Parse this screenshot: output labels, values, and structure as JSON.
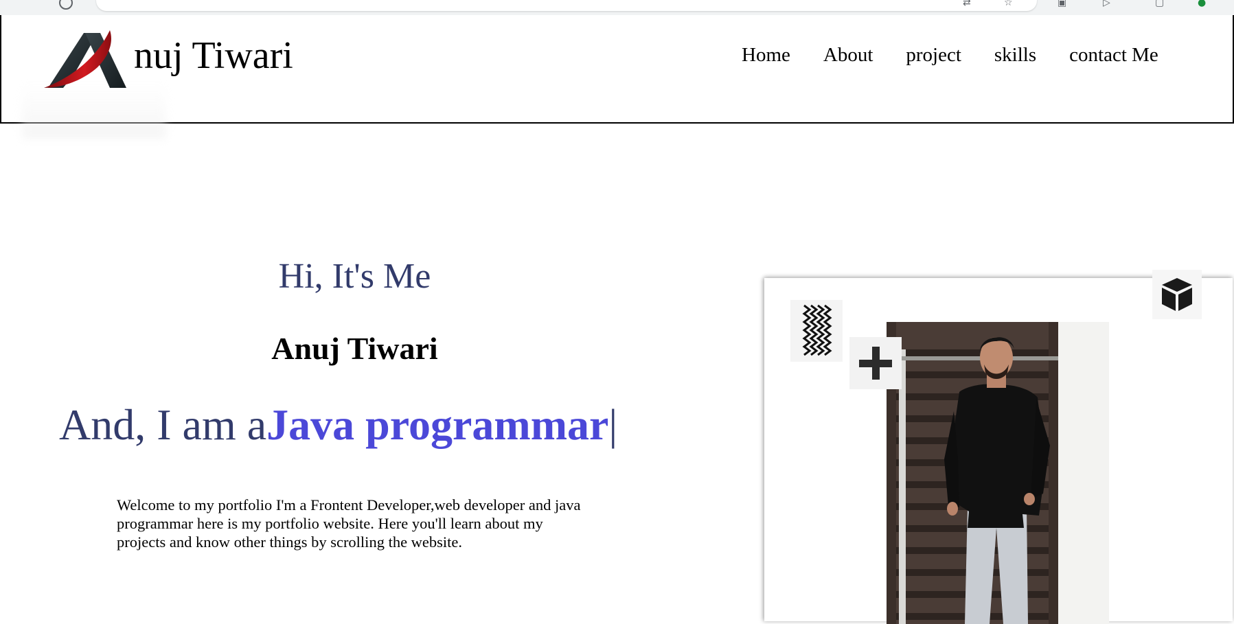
{
  "site": {
    "brand_text": "nuj Tiwari",
    "logo_icon": "anuj-logo-icon"
  },
  "nav": {
    "items": [
      {
        "label": "Home"
      },
      {
        "label": "About"
      },
      {
        "label": "project"
      },
      {
        "label": "skills"
      },
      {
        "label": "contact Me"
      }
    ]
  },
  "hero": {
    "greeting": "Hi, It's Me",
    "name": "Anuj Tiwari",
    "role_prefix": "And, I am a",
    "role_typed": "Java programmar",
    "role_cursor": "|",
    "description": "Welcome to my portfolio I'm a Frontent Developer,web developer and java programmar here is my portfolio website. Here you'll learn about my projects and know other things by scrolling the website."
  },
  "photo_card": {
    "icons": [
      "zigzag-icon",
      "plus-icon",
      "cube-icon"
    ],
    "portrait": "profile-photo"
  },
  "colors": {
    "greeting": "#323b6b",
    "accent": "#4b48d8",
    "text": "#000000",
    "logo_red": "#c0151b",
    "logo_dark": "#1f2a2e"
  }
}
